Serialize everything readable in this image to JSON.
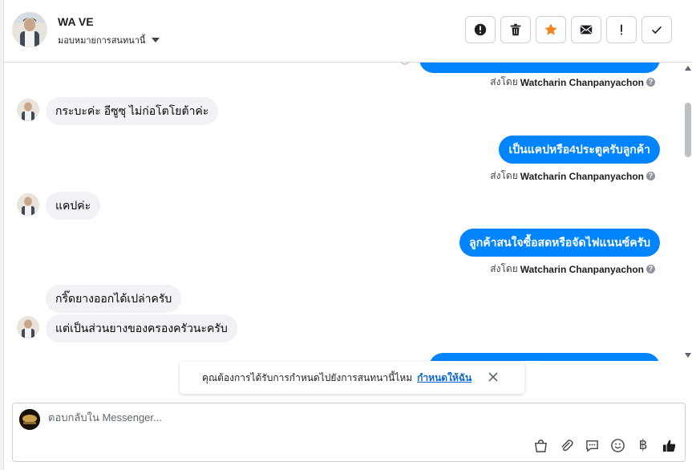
{
  "header": {
    "contact_name": "WA VE",
    "assign_label": "มอบหมายการสนทนานี้"
  },
  "actions": [
    {
      "icon": "alert-circle-icon"
    },
    {
      "icon": "trash-icon"
    },
    {
      "icon": "star-icon",
      "color": "#f5821f"
    },
    {
      "icon": "envelope-icon"
    },
    {
      "icon": "exclamation-icon"
    },
    {
      "icon": "check-icon"
    }
  ],
  "messages": [
    {
      "direction": "in",
      "text": "กระบะค่ะ อีซูซุ ไม่ก่อโตโยต้าค่ะ"
    },
    {
      "direction": "out",
      "text": "เป็นแคปหรือ4ประตูครับลูกค้า"
    },
    {
      "direction": "in",
      "text": "แคปค่ะ"
    },
    {
      "direction": "out",
      "text": "ลูกค้าสนใจซื้อสดหรือจัดไฟแนนซ์ครับ"
    },
    {
      "direction": "in",
      "text": "กริ๊ดยางออกได้เปล่าครับ"
    },
    {
      "direction": "in",
      "text": "แต่เป็นส่วนยางของครองครัวนะครับ"
    }
  ],
  "sent_by": {
    "prefix": "ส่งโดย",
    "name": "Watcharin Chanpanyachon",
    "help": "?"
  },
  "notice": {
    "text": "คุณต้องการได้รับการกำหนดไปยังการสนทนานี้ไหม",
    "link": "กำหนดให้ฉัน"
  },
  "composer": {
    "placeholder": "ตอบกลับใน Messenger...",
    "baht_symbol": "฿"
  },
  "colors": {
    "outgoing_bubble": "#0084ff",
    "incoming_bubble": "#f0f2f5",
    "link": "#0a66d9"
  }
}
